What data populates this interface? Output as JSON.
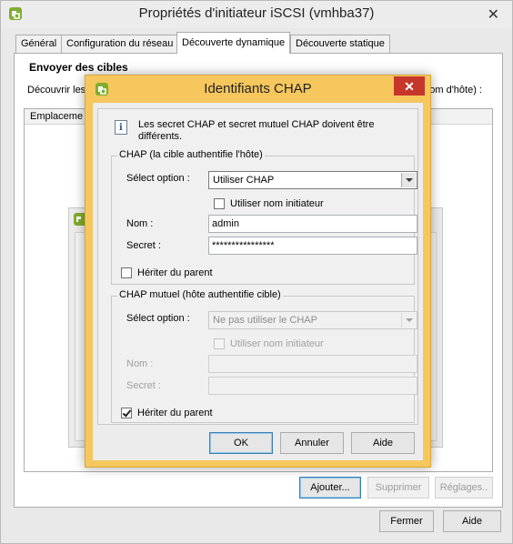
{
  "main_window": {
    "title": "Propriétés d'initiateur iSCSI (vmhba37)",
    "close_glyph": "✕",
    "tabs": [
      {
        "label": "Général"
      },
      {
        "label": "Configuration du réseau"
      },
      {
        "label": "Découverte dynamique"
      },
      {
        "label": "Découverte statique"
      }
    ],
    "active_tab": "Découverte dynamique",
    "section_heading": "Envoyer des cibles",
    "discover_label_start": "Découvrir les",
    "discover_label_end": "om d'hôte) :",
    "list_header_column": "Emplaceme",
    "buttons": {
      "add": "Ajouter...",
      "remove": "Supprimer",
      "settings": "Réglages..",
      "close": "Fermer",
      "help": "Aide"
    }
  },
  "chap_dialog": {
    "title": "Identifiants CHAP",
    "close_glyph": "✕",
    "info_text": "Les secret CHAP et secret mutuel CHAP doivent être différents.",
    "chap_group": {
      "legend": "CHAP (la cible authentifie l'hôte)",
      "select_label": "Sélect option :",
      "select_value": "Utiliser CHAP",
      "use_initiator_name_label": "Utiliser nom initiateur",
      "use_initiator_name_checked": false,
      "name_label": "Nom :",
      "name_value": "admin",
      "secret_label": "Secret :",
      "secret_value": "****************",
      "inherit_label": "Hériter du parent",
      "inherit_checked": false
    },
    "mutual_group": {
      "legend": "CHAP mutuel (hôte authentifie cible)",
      "select_label": "Sélect option :",
      "select_value": "Ne pas utiliser le CHAP",
      "use_initiator_name_label": "Utiliser nom initiateur",
      "use_initiator_name_checked": false,
      "name_label": "Nom :",
      "name_value": "",
      "secret_label": "Secret :",
      "secret_value": "",
      "inherit_label": "Hériter du parent",
      "inherit_checked": true
    },
    "buttons": {
      "ok": "OK",
      "cancel": "Annuler",
      "help": "Aide"
    }
  },
  "colors": {
    "dialog_frame_accent": "#f5c75d",
    "close_button": "#c7362a",
    "default_button_border": "#3c7fb1"
  },
  "icons": {
    "app_icon": "vmware-vsphere-logo-icon",
    "info_icon": "information-icon",
    "dropdown_icon": "chevron-down-icon"
  }
}
